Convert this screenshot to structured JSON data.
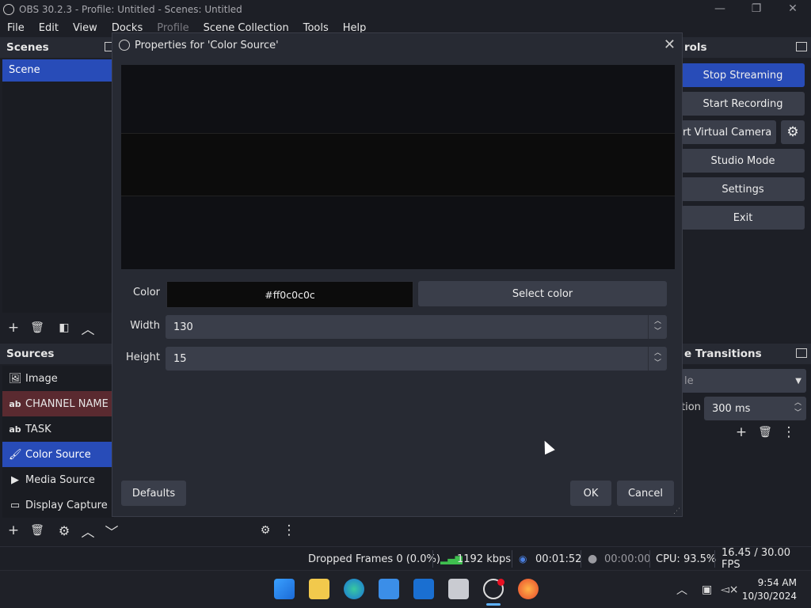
{
  "window": {
    "title": "OBS 30.2.3 - Profile: Untitled - Scenes: Untitled",
    "minimize": "—",
    "maximize": "❐",
    "close": "✕"
  },
  "menu": [
    "File",
    "Edit",
    "View",
    "Docks",
    "Profile",
    "Scene Collection",
    "Tools",
    "Help"
  ],
  "scenes": {
    "title": "Scenes",
    "items": [
      "Scene"
    ]
  },
  "sources": {
    "title": "Sources",
    "items": [
      {
        "label": "Image",
        "icon": "image-icon"
      },
      {
        "label": "CHANNEL NAME",
        "icon": "text-icon"
      },
      {
        "label": "TASK",
        "icon": "text-icon"
      },
      {
        "label": "Color Source",
        "icon": "brush-icon"
      },
      {
        "label": "Media Source",
        "icon": "play-icon"
      },
      {
        "label": "Display Capture",
        "icon": "monitor-icon"
      }
    ]
  },
  "controls": {
    "title": "rols",
    "stop_streaming": "Stop Streaming",
    "start_recording": "Start Recording",
    "virtual_camera": "rt Virtual Camera",
    "studio_mode": "Studio Mode",
    "settings": "Settings",
    "exit": "Exit"
  },
  "transitions": {
    "title": "e Transitions",
    "fade_partial": "le",
    "duration_label_partial": "tion",
    "duration_value": "300 ms"
  },
  "dialog": {
    "title": "Properties for 'Color Source'",
    "color_label": "Color",
    "color_value": "#ff0c0c0c",
    "swatch_color": "#0c0c0c",
    "select_color": "Select color",
    "width_label": "Width",
    "width_value": "130",
    "height_label": "Height",
    "height_value": "15",
    "defaults": "Defaults",
    "ok": "OK",
    "cancel": "Cancel"
  },
  "status": {
    "dropped_frames": "Dropped Frames 0 (0.0%)",
    "bitrate": "1192 kbps",
    "stream_time": "00:01:52",
    "record_time": "00:00:00",
    "cpu": "CPU: 93.5%",
    "fps": "16.45 / 30.00 FPS"
  },
  "taskbar": {
    "time": "9:54 AM",
    "date": "10/30/2024"
  }
}
